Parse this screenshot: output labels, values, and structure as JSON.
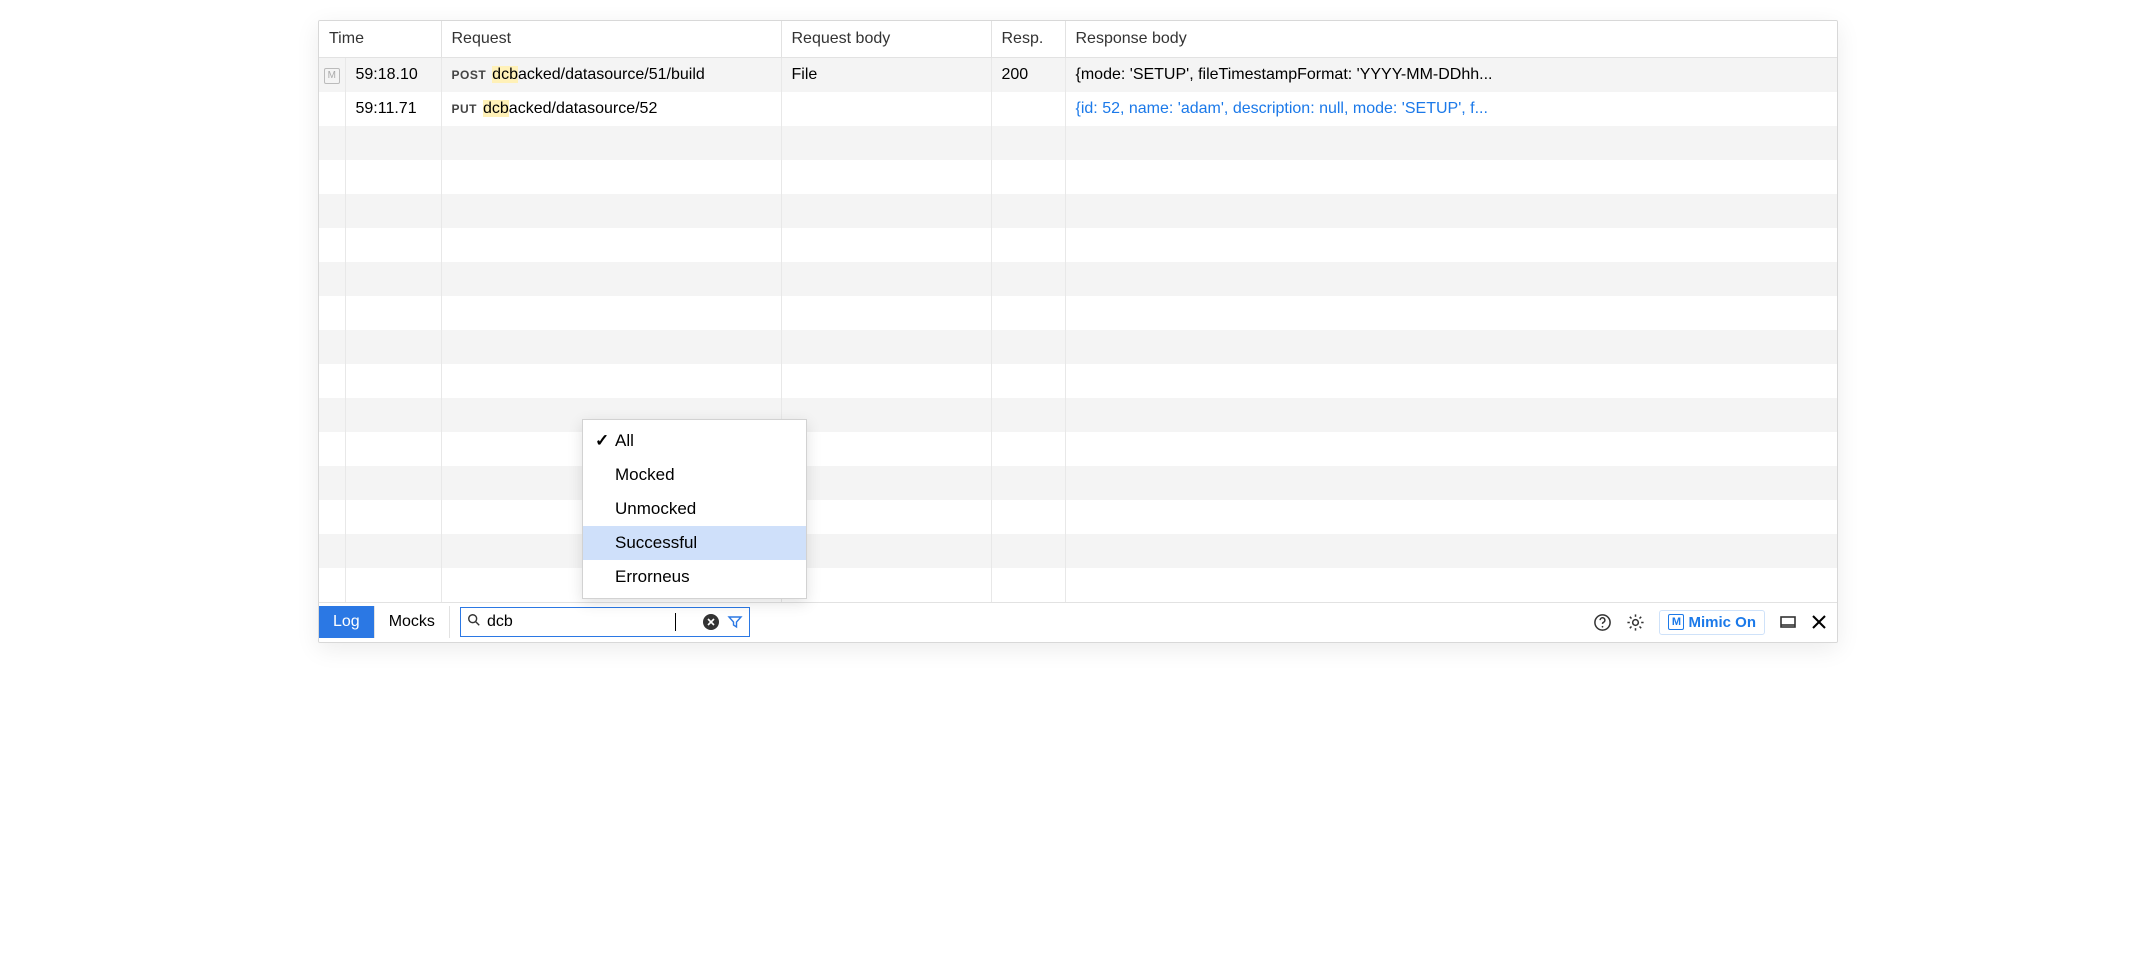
{
  "table": {
    "headers": {
      "time": "Time",
      "request": "Request",
      "request_body": "Request body",
      "resp": "Resp.",
      "response_body": "Response body"
    },
    "rows": [
      {
        "icon": "M",
        "time": "59:18.10",
        "method": "POST",
        "path_prefix": "dcb",
        "path_rest": "acked/datasource/51/build",
        "request_body": "File",
        "resp": "200",
        "response_body": "{mode: 'SETUP', fileTimestampFormat: 'YYYY-MM-DDhh...",
        "response_link": false
      },
      {
        "icon": "",
        "time": "59:11.71",
        "method": "PUT",
        "path_prefix": "dcb",
        "path_rest": "acked/datasource/52",
        "request_body": "",
        "resp": "",
        "response_body": "{id: 52, name: 'adam', description: null, mode: 'SETUP', f...",
        "response_link": true
      }
    ],
    "empty_rows": 14
  },
  "filter_menu": {
    "items": [
      {
        "label": "All",
        "checked": true,
        "hovered": false
      },
      {
        "label": "Mocked",
        "checked": false,
        "hovered": false
      },
      {
        "label": "Unmocked",
        "checked": false,
        "hovered": false
      },
      {
        "label": "Successful",
        "checked": false,
        "hovered": true
      },
      {
        "label": "Errorneus",
        "checked": false,
        "hovered": false
      }
    ]
  },
  "bottom": {
    "tabs": {
      "log": "Log",
      "mocks": "Mocks"
    },
    "search_value": "dcb",
    "mimic_label": "Mimic On"
  }
}
